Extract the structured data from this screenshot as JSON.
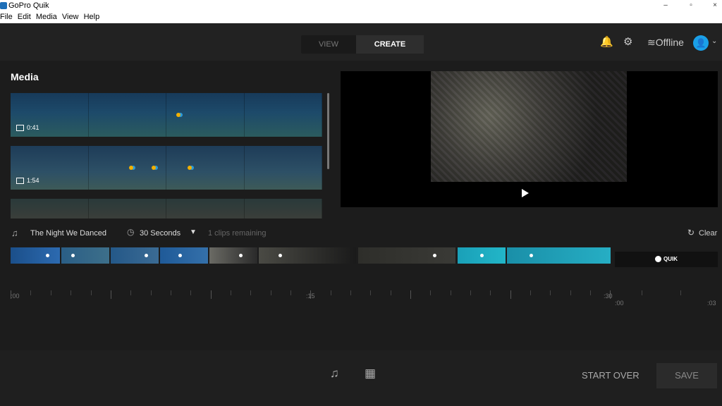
{
  "window": {
    "title": "GoPro Quik",
    "minimize": "–",
    "maximize": "▫",
    "close": "×"
  },
  "menu": [
    "File",
    "Edit",
    "Media",
    "View",
    "Help"
  ],
  "mode_tabs": {
    "view": "VIEW",
    "create": "CREATE"
  },
  "header": {
    "status": "Offline",
    "avatar": "👤",
    "bell_icon": "🔔",
    "gear_icon": "⚙",
    "offline_icon": "≋",
    "chevron": "⌄"
  },
  "media": {
    "title": "Media",
    "clips": [
      {
        "duration": "0:41"
      },
      {
        "duration": "1:54"
      }
    ]
  },
  "music": {
    "song": "The Night We Danced",
    "duration": "30 Seconds",
    "remaining": "1 clips remaining",
    "clear": "Clear"
  },
  "quik_badge": "QUIK",
  "ruler": {
    "labels": [
      ":00",
      ":15",
      ":30",
      ":00",
      ":03"
    ]
  },
  "footer": {
    "start_over": "START OVER",
    "save": "SAVE"
  },
  "colors": {
    "accent": "#1aa0e8",
    "background": "#1c1c1c",
    "marker_yellow": "#f2b000",
    "marker_blue": "#2b9ad8"
  }
}
